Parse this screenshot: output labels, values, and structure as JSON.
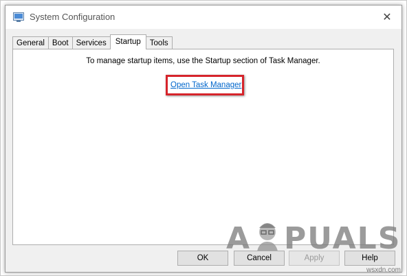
{
  "window": {
    "title": "System Configuration",
    "close_glyph": "✕",
    "icon": "msconfig-icon"
  },
  "tabs": [
    {
      "label": "General",
      "active": false
    },
    {
      "label": "Boot",
      "active": false
    },
    {
      "label": "Services",
      "active": false
    },
    {
      "label": "Startup",
      "active": true
    },
    {
      "label": "Tools",
      "active": false
    }
  ],
  "startup_panel": {
    "message": "To manage startup items, use the Startup section of Task Manager.",
    "link_label": "Open Task Manager"
  },
  "buttons": {
    "ok": "OK",
    "cancel": "Cancel",
    "apply": "Apply",
    "help": "Help"
  },
  "watermark": {
    "brand_left": "A",
    "brand_right": "PUALS"
  },
  "site_tag": "wsxdn.com",
  "colors": {
    "highlight": "#d6242b",
    "link": "#0066cc"
  }
}
